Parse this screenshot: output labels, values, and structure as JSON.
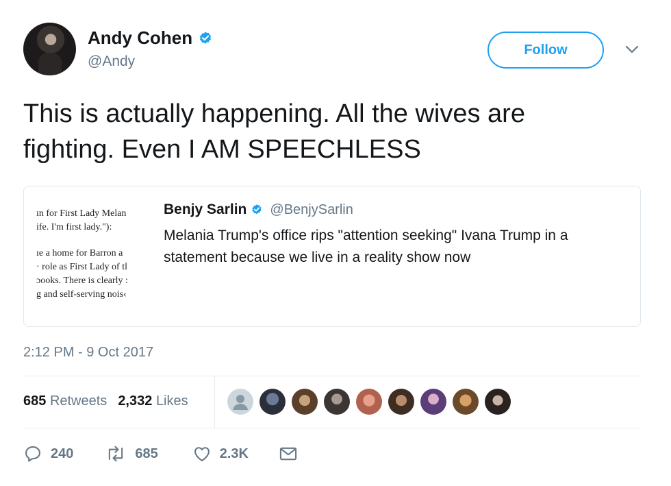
{
  "author": {
    "name": "Andy Cohen",
    "handle": "@Andy",
    "verified_icon": "verified-badge-icon",
    "avatar": "profile-photo-andy-cohen"
  },
  "follow_label": "Follow",
  "more_icon": "chevron-down-icon",
  "tweet": {
    "text_line1": "This is actually happening. All the wives are",
    "text_line2": "fighting. Even I AM SPEECHLESS"
  },
  "quoted": {
    "name": "Benjy Sarlin",
    "handle": "@BenjySarlin",
    "text_line1": "Melania Trump's office rips \"attention seeking\" Ivana Trump in a",
    "text_line2": "statement because we live in a reality show now",
    "thumbnail_lines": [
      "ın for First Lady Melan",
      "ife. I'm first lady.\"):",
      "ıe a home for Barron a",
      "· role as First Lady of tl",
      "ɔooks. There is clearly :",
      "g and self-serving nois‹"
    ]
  },
  "timestamp": "2:12 PM - 9 Oct 2017",
  "stats": {
    "retweets_count": "685",
    "retweets_label": "Retweets",
    "likes_count": "2,332",
    "likes_label": "Likes"
  },
  "liker_avatars": [
    "default-avatar",
    "liker-avatar",
    "liker-avatar",
    "liker-avatar",
    "liker-avatar",
    "liker-avatar",
    "liker-avatar",
    "liker-avatar",
    "liker-avatar"
  ],
  "actions": {
    "reply_count": "240",
    "retweet_count": "685",
    "like_count": "2.3K",
    "reply_icon": "reply-icon",
    "retweet_icon": "retweet-icon",
    "like_icon": "heart-icon",
    "dm_icon": "envelope-icon"
  },
  "colors": {
    "accent": "#1da1f2",
    "secondary_text": "#657786",
    "divider": "#e6ecf0"
  }
}
